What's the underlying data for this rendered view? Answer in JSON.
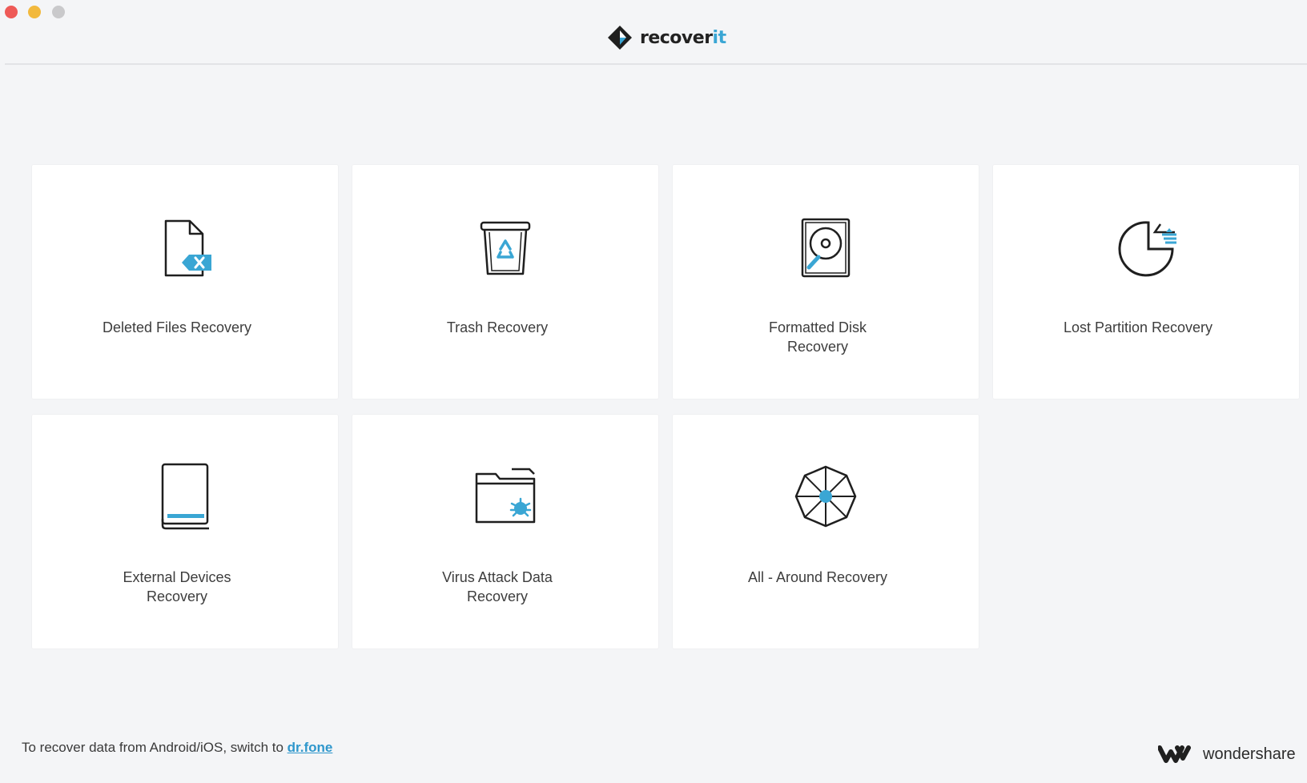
{
  "window": {
    "buttons": [
      "close",
      "minimize",
      "maximize"
    ]
  },
  "header": {
    "brand_main": "recover",
    "brand_accent": "it",
    "logo_icon": "recoverit-diamond-icon"
  },
  "cards": [
    {
      "label": "Deleted Files Recovery",
      "icon": "deleted-file-icon"
    },
    {
      "label": "Trash Recovery",
      "icon": "trash-bin-icon"
    },
    {
      "label": "Formatted Disk Recovery",
      "icon": "hard-disk-icon"
    },
    {
      "label": "Lost Partition Recovery",
      "icon": "partition-pie-icon"
    },
    {
      "label": "External Devices Recovery",
      "icon": "external-device-icon"
    },
    {
      "label": "Virus Attack Data Recovery",
      "icon": "virus-folder-icon"
    },
    {
      "label": "All - Around Recovery",
      "icon": "all-around-compass-icon"
    }
  ],
  "footer": {
    "note_prefix": "To recover data from Android/iOS, switch to ",
    "link_text": "dr.fone",
    "company": "wondershare",
    "company_logo": "wondershare-logo-icon"
  },
  "colors": {
    "accent": "#3aa6d4",
    "background": "#f4f5f7",
    "card": "#ffffff"
  }
}
